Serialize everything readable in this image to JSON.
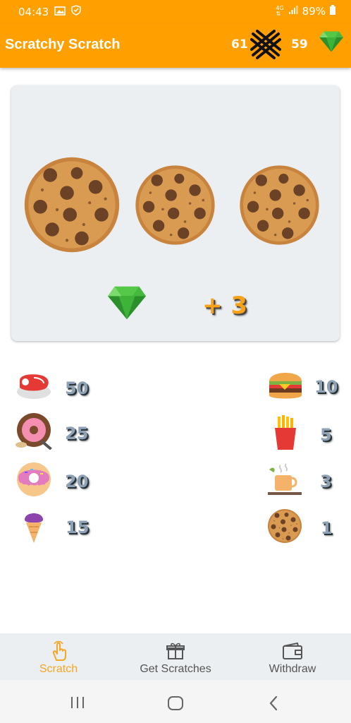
{
  "status_bar": {
    "time": "04:43",
    "battery": "89%"
  },
  "app_bar": {
    "title": "Scratchy Scratch",
    "scratch_count": "61",
    "gem_count": "59"
  },
  "scratch_card": {
    "symbols": [
      "cookie",
      "cookie",
      "cookie"
    ],
    "prize_icon": "gem-icon",
    "prize_value": "+ 3"
  },
  "prizes": {
    "left": [
      {
        "icon": "steak-icon",
        "value": "50"
      },
      {
        "icon": "donut-plate-icon",
        "value": "25"
      },
      {
        "icon": "donut-icon",
        "value": "20"
      },
      {
        "icon": "ice-cream-icon",
        "value": "15"
      }
    ],
    "right": [
      {
        "icon": "burger-icon",
        "value": "10"
      },
      {
        "icon": "fries-icon",
        "value": "5"
      },
      {
        "icon": "tea-icon",
        "value": "3"
      },
      {
        "icon": "cookie-icon",
        "value": "1"
      }
    ]
  },
  "nav": {
    "scratch": "Scratch",
    "get_scratches": "Get Scratches",
    "withdraw": "Withdraw"
  },
  "colors": {
    "accent": "#ffa000",
    "active_tab": "#f5a623",
    "card_bg": "#eceff1"
  }
}
